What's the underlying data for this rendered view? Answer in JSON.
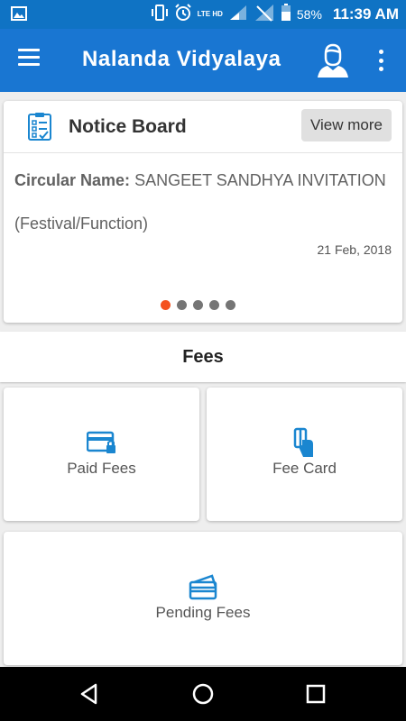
{
  "status_bar": {
    "network_label": "LTE HD",
    "battery_percent": "58%",
    "time": "11:39 AM"
  },
  "app_bar": {
    "title": "Nalanda Vidyalaya"
  },
  "notice_board": {
    "title": "Notice Board",
    "view_more_label": "View more",
    "circular_label": "Circular Name:",
    "circular_name": " SANGEET SANDHYA INVITATION",
    "category": "(Festival/Function)",
    "date": "21 Feb, 2018",
    "pager": {
      "count": 5,
      "active_index": 0
    }
  },
  "fees": {
    "section_title": "Fees",
    "tiles": [
      {
        "label": "Paid Fees",
        "icon": "credit-card-lock-icon"
      },
      {
        "label": "Fee Card",
        "icon": "hand-card-icon"
      },
      {
        "label": "Pending Fees",
        "icon": "stacked-cards-icon"
      }
    ]
  },
  "colors": {
    "status_bar": "#0f73c4",
    "app_bar": "#1976d2",
    "icon_blue": "#1a86d0",
    "active_dot": "#f4511e"
  }
}
